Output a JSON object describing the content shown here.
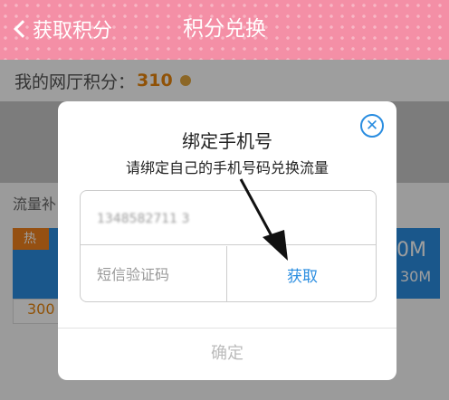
{
  "header": {
    "back_label": "获取积分",
    "title": "积分兑换"
  },
  "points": {
    "label": "我的网厅积分：",
    "value": "310"
  },
  "section": {
    "label": "流量补"
  },
  "card": {
    "badge": "热",
    "big": "0M",
    "small": "30M",
    "foot": "300"
  },
  "dialog": {
    "title": "绑定手机号",
    "subtitle": "请绑定自己的手机号码兑换流量",
    "phone_value": "1348582711 3",
    "code_placeholder": "短信验证码",
    "get_code_label": "获取",
    "confirm_label": "确定"
  },
  "colors": {
    "header_bg": "#f48fa6",
    "accent": "#2a8de0",
    "points": "#e8850c"
  },
  "icons": {
    "close": "close-icon",
    "back": "chevron-left-icon",
    "coin": "coin-icon"
  }
}
